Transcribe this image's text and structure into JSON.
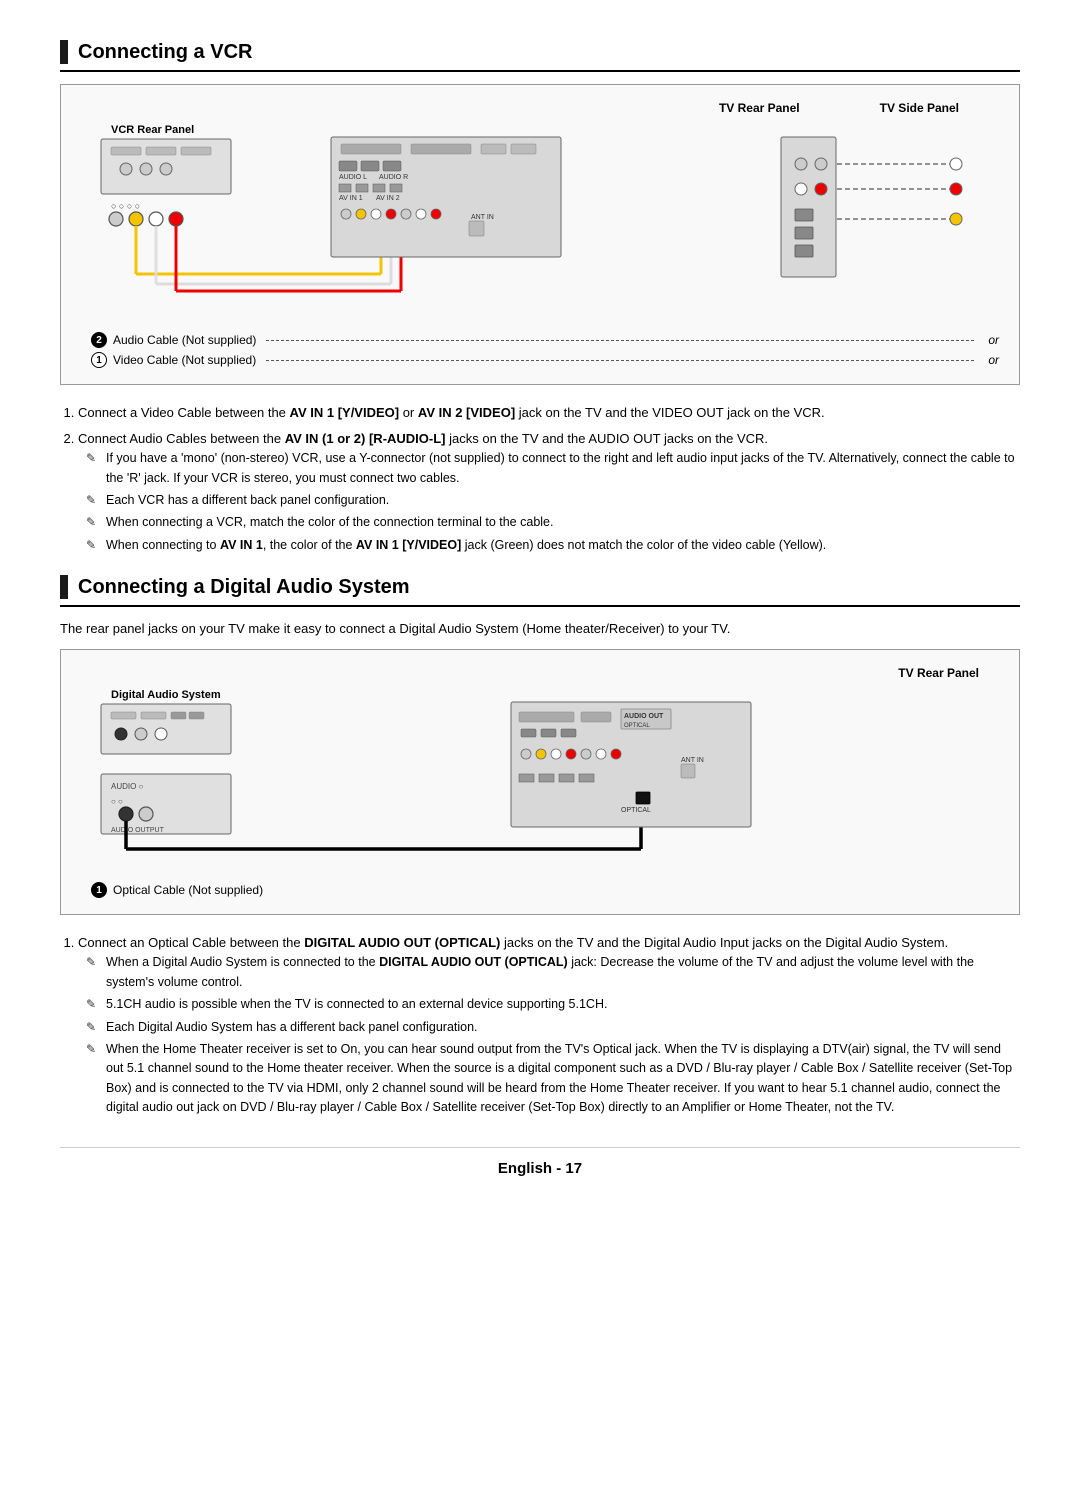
{
  "vcr_section": {
    "heading": "Connecting a VCR",
    "diagram": {
      "tv_rear_panel_label": "TV Rear Panel",
      "tv_side_panel_label": "TV Side Panel",
      "vcr_rear_panel_label": "VCR Rear Panel",
      "caption1_text": "Video Cable (Not supplied)",
      "caption1_number": "1",
      "caption2_text": "Audio Cable (Not supplied)",
      "caption2_number": "2",
      "or_text": "or"
    },
    "instructions": [
      {
        "number": "1",
        "text": "Connect a Video Cable between the AV IN 1 [Y/VIDEO] or AV IN 2 [VIDEO] jack on the TV and the VIDEO OUT jack on the VCR."
      },
      {
        "number": "2",
        "text": "Connect Audio Cables between the AV IN (1 or 2) [R-AUDIO-L] jacks on the TV and the AUDIO OUT jacks on the VCR."
      }
    ],
    "notes": [
      "If you have a 'mono' (non-stereo) VCR, use a Y-connector (not supplied) to connect to the right and left audio input jacks of the TV. Alternatively, connect the cable to the 'R' jack. If your VCR is stereo, you must connect two cables.",
      "Each VCR has a different back panel configuration.",
      "When connecting a VCR, match the color of the connection terminal to the cable.",
      "When connecting to AV IN 1, the color of the AV IN 1 [Y/VIDEO] jack (Green) does not match the color of the video cable (Yellow)."
    ]
  },
  "das_section": {
    "heading": "Connecting a Digital Audio System",
    "intro": "The rear panel jacks on your TV make it easy to connect a Digital Audio System (Home theater/Receiver) to your TV.",
    "diagram": {
      "tv_rear_panel_label": "TV Rear Panel",
      "das_label": "Digital Audio System",
      "caption1_text": "Optical Cable (Not supplied)",
      "caption1_number": "1"
    },
    "instructions": [
      {
        "number": "1",
        "text": "Connect an Optical Cable between the DIGITAL AUDIO OUT (OPTICAL) jacks on the TV and the Digital Audio Input jacks on the Digital Audio System."
      }
    ],
    "notes": [
      "When a Digital Audio System is connected to the DIGITAL AUDIO OUT (OPTICAL) jack: Decrease the volume of the TV and adjust the volume level with the system's volume control.",
      "5.1CH audio is possible when the TV is connected to an external device supporting 5.1CH.",
      "Each Digital Audio System has a different back panel configuration.",
      "When the Home Theater receiver is set to On, you can hear sound output from the TV's Optical jack. When the TV is displaying a DTV(air) signal, the TV will send out 5.1 channel sound to the Home theater receiver. When the source is a digital component such as a DVD / Blu-ray player / Cable Box / Satellite receiver (Set-Top Box) and is connected to the TV via HDMI, only 2 channel sound will be heard from the Home Theater receiver. If you want to hear 5.1 channel audio, connect the digital audio out jack on DVD / Blu-ray player / Cable Box / Satellite receiver (Set-Top Box) directly to an Amplifier or Home Theater, not the TV."
    ]
  },
  "footer": {
    "text": "English - 17"
  }
}
